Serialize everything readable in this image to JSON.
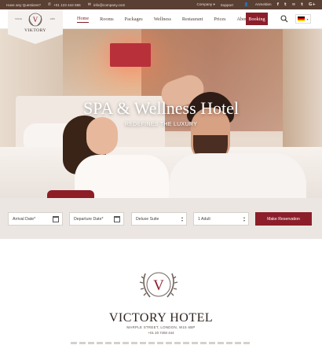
{
  "topbar": {
    "question": "Have any Questions?",
    "phone": "+01 123 444 555",
    "email": "info@company.com",
    "company": "Company",
    "support": "Support",
    "login": "Anmelden",
    "social_icons": [
      "facebook-icon",
      "twitter-icon",
      "tripadvisor-icon",
      "tumblr-icon",
      "google-plus-icon"
    ]
  },
  "logo": {
    "since": "SINCE",
    "year": "1985",
    "brand": "VIKTORY"
  },
  "nav": {
    "items": [
      {
        "label": "Home",
        "active": true
      },
      {
        "label": "Rooms"
      },
      {
        "label": "Packages"
      },
      {
        "label": "Wellness"
      },
      {
        "label": "Restaurant"
      },
      {
        "label": "Prices"
      },
      {
        "label": "About"
      }
    ],
    "booking": "Booking",
    "language_flag": "de-flag"
  },
  "hero": {
    "title": "SPA & Wellness Hotel",
    "subtitle": "REDEFINES THE LUXURY"
  },
  "booking_form": {
    "arrival_placeholder": "Arrival Date*",
    "departure_placeholder": "Departure Date*",
    "room_value": "Deluxe Suite",
    "guests_value": "1 Adult",
    "submit": "Make Reservation"
  },
  "about": {
    "name": "VICTORY HOTEL",
    "address": "MARPLE STREET, LONDON, W15 6BP",
    "phone": "+01 20 7493 444"
  },
  "colors": {
    "accent": "#8b1e2a",
    "topbar": "#5a3f33",
    "form_bg": "#ebe6e2"
  }
}
